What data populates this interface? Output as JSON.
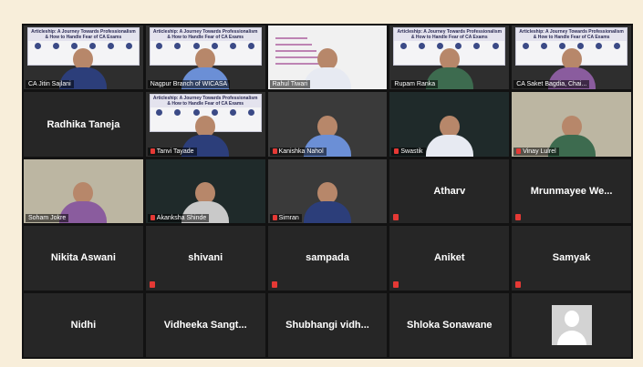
{
  "meeting": {
    "tiles": [
      {
        "kind": "video",
        "name": "CA Jitin Sajlani",
        "scene": "slide-person"
      },
      {
        "kind": "video",
        "name": "Nagpur Branch of WICASA",
        "scene": "slide-person",
        "active": true
      },
      {
        "kind": "video",
        "name": "Rahul Tiwari",
        "scene": "whiteboard"
      },
      {
        "kind": "video",
        "name": "Rupam Ranka",
        "scene": "slide-person"
      },
      {
        "kind": "video",
        "name": "CA Saket Bagdia, Chai...",
        "scene": "slide-person"
      },
      {
        "kind": "name",
        "name": "Radhika Taneja",
        "muted": false
      },
      {
        "kind": "video",
        "name": "Tanvi Tayade",
        "scene": "slide-person",
        "muted": true
      },
      {
        "kind": "video",
        "name": "Kanishka Nahol",
        "scene": "person",
        "muted": true
      },
      {
        "kind": "video",
        "name": "Swastik",
        "scene": "person-dark",
        "muted": true
      },
      {
        "kind": "video",
        "name": "Vinay Lulrel",
        "scene": "person-light",
        "muted": true
      },
      {
        "kind": "video",
        "name": "Soham Jokre",
        "scene": "person-light",
        "muted": false
      },
      {
        "kind": "video",
        "name": "Akanksha Shinde",
        "scene": "person-dark",
        "muted": true
      },
      {
        "kind": "video",
        "name": "Simran",
        "scene": "person",
        "muted": true
      },
      {
        "kind": "name",
        "name": "Atharv",
        "muted": true
      },
      {
        "kind": "name",
        "name": "Mrunmayee We...",
        "muted": true
      },
      {
        "kind": "name",
        "name": "Nikita Aswani",
        "muted": false
      },
      {
        "kind": "name",
        "name": "shivani",
        "muted": true
      },
      {
        "kind": "name",
        "name": "sampada",
        "muted": true
      },
      {
        "kind": "name",
        "name": "Aniket",
        "muted": true
      },
      {
        "kind": "name",
        "name": "Samyak",
        "muted": true
      },
      {
        "kind": "name",
        "name": "Nidhi",
        "muted": false
      },
      {
        "kind": "name",
        "name": "Vidheeka Sangt...",
        "muted": false
      },
      {
        "kind": "name",
        "name": "Shubhangi vidh...",
        "muted": false
      },
      {
        "kind": "name",
        "name": "Shloka Sonawane",
        "muted": false
      },
      {
        "kind": "avatar",
        "name": "",
        "muted": false
      }
    ],
    "slide_text": "Articleship: A Journey Towards Professionalism & How to Handle Fear of CA Exams",
    "colors": {
      "active_border": "#b8e04a",
      "muted_icon": "#e53935",
      "tile_bg": "#262626"
    }
  }
}
